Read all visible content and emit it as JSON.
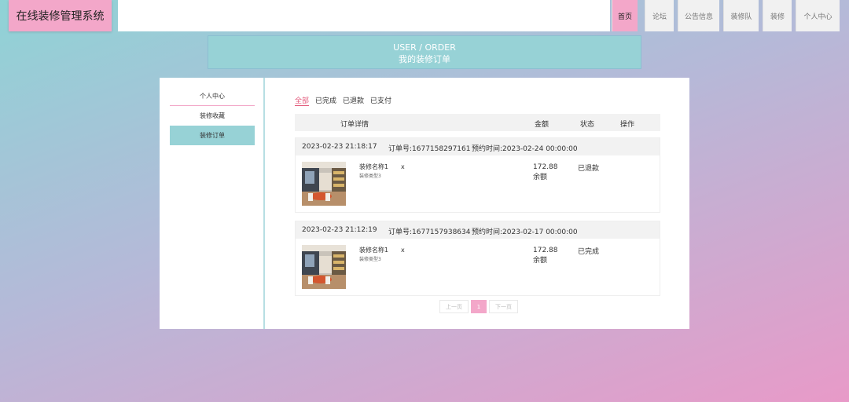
{
  "app": {
    "title": "在线装修管理系统"
  },
  "nav": [
    {
      "label": "首页",
      "active": true
    },
    {
      "label": "论坛"
    },
    {
      "label": "公告信息"
    },
    {
      "label": "装修队"
    },
    {
      "label": "装修"
    },
    {
      "label": "个人中心"
    }
  ],
  "banner": {
    "en": "USER / ORDER",
    "zh": "我的装修订单"
  },
  "sidebar": {
    "head": "个人中心",
    "items": [
      {
        "label": "装修收藏"
      },
      {
        "label": "装修订单",
        "active": true
      }
    ]
  },
  "tabs": [
    "全部",
    "已完成",
    "已退款",
    "已支付"
  ],
  "table_headers": {
    "detail": "订单详情",
    "amount": "金额",
    "status": "状态",
    "action": "操作"
  },
  "orders": [
    {
      "created": "2023-02-23 21:18:17",
      "order_no": "订单号:1677158297161",
      "appointment": "预约时间:2023-02-24 00:00:00",
      "name": "装修名称1",
      "type": "装修类型3",
      "qty": "x",
      "amount": "172.88",
      "pay": "余额",
      "status": "已退款"
    },
    {
      "created": "2023-02-23 21:12:19",
      "order_no": "订单号:1677157938634",
      "appointment": "预约时间:2023-02-17 00:00:00",
      "name": "装修名称1",
      "type": "装修类型3",
      "qty": "x",
      "amount": "172.88",
      "pay": "余额",
      "status": "已完成"
    }
  ],
  "pager": {
    "prev": "上一页",
    "current": "1",
    "next": "下一页"
  },
  "colors": {
    "accent": "#f3a7c9",
    "teal": "#97d2d6",
    "active_tab": "#e35b7c"
  }
}
